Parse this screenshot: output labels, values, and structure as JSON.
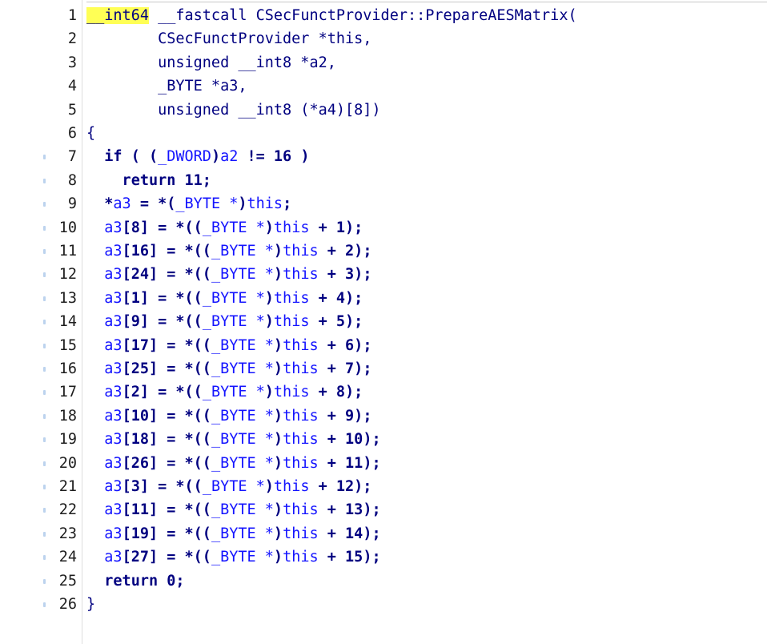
{
  "editor": {
    "lines": [
      {
        "num": "1",
        "bp": false,
        "tokens": [
          {
            "t": "__int64",
            "c": "t-hl"
          },
          {
            "t": " __fastcall CSecFunctProvider::PrepareAESMatrix(",
            "c": "t-default"
          }
        ]
      },
      {
        "num": "2",
        "bp": false,
        "tokens": [
          {
            "t": "        CSecFunctProvider *this,",
            "c": "t-default"
          }
        ]
      },
      {
        "num": "3",
        "bp": false,
        "tokens": [
          {
            "t": "        unsigned __int8 *a2,",
            "c": "t-default"
          }
        ]
      },
      {
        "num": "4",
        "bp": false,
        "tokens": [
          {
            "t": "        _BYTE *a3,",
            "c": "t-default"
          }
        ]
      },
      {
        "num": "5",
        "bp": false,
        "tokens": [
          {
            "t": "        unsigned __int8 (*a4)[8])",
            "c": "t-default"
          }
        ]
      },
      {
        "num": "6",
        "bp": false,
        "tokens": [
          {
            "t": "{",
            "c": "t-default"
          }
        ]
      },
      {
        "num": "7",
        "bp": true,
        "tokens": [
          {
            "t": "  if ( (",
            "c": "t-kw"
          },
          {
            "t": "_DWORD",
            "c": "t-type"
          },
          {
            "t": ")",
            "c": "t-kw"
          },
          {
            "t": "a2",
            "c": "t-var"
          },
          {
            "t": " != 16 )",
            "c": "t-kw"
          }
        ]
      },
      {
        "num": "8",
        "bp": true,
        "tokens": [
          {
            "t": "    return 11;",
            "c": "t-kw"
          }
        ]
      },
      {
        "num": "9",
        "bp": true,
        "tokens": [
          {
            "t": "  *",
            "c": "t-kw"
          },
          {
            "t": "a3",
            "c": "t-var"
          },
          {
            "t": " = *(",
            "c": "t-kw"
          },
          {
            "t": "_BYTE *",
            "c": "t-type"
          },
          {
            "t": ")",
            "c": "t-kw"
          },
          {
            "t": "this",
            "c": "t-var"
          },
          {
            "t": ";",
            "c": "t-kw"
          }
        ]
      },
      {
        "num": "10",
        "bp": true,
        "tokens": [
          {
            "t": "  ",
            "c": "t-kw"
          },
          {
            "t": "a3",
            "c": "t-var"
          },
          {
            "t": "[8] = *((",
            "c": "t-kw"
          },
          {
            "t": "_BYTE *",
            "c": "t-type"
          },
          {
            "t": ")",
            "c": "t-kw"
          },
          {
            "t": "this",
            "c": "t-var"
          },
          {
            "t": " + 1);",
            "c": "t-kw"
          }
        ]
      },
      {
        "num": "11",
        "bp": true,
        "tokens": [
          {
            "t": "  ",
            "c": "t-kw"
          },
          {
            "t": "a3",
            "c": "t-var"
          },
          {
            "t": "[16] = *((",
            "c": "t-kw"
          },
          {
            "t": "_BYTE *",
            "c": "t-type"
          },
          {
            "t": ")",
            "c": "t-kw"
          },
          {
            "t": "this",
            "c": "t-var"
          },
          {
            "t": " + 2);",
            "c": "t-kw"
          }
        ]
      },
      {
        "num": "12",
        "bp": true,
        "tokens": [
          {
            "t": "  ",
            "c": "t-kw"
          },
          {
            "t": "a3",
            "c": "t-var"
          },
          {
            "t": "[24] = *((",
            "c": "t-kw"
          },
          {
            "t": "_BYTE *",
            "c": "t-type"
          },
          {
            "t": ")",
            "c": "t-kw"
          },
          {
            "t": "this",
            "c": "t-var"
          },
          {
            "t": " + 3);",
            "c": "t-kw"
          }
        ]
      },
      {
        "num": "13",
        "bp": true,
        "tokens": [
          {
            "t": "  ",
            "c": "t-kw"
          },
          {
            "t": "a3",
            "c": "t-var"
          },
          {
            "t": "[1] = *((",
            "c": "t-kw"
          },
          {
            "t": "_BYTE *",
            "c": "t-type"
          },
          {
            "t": ")",
            "c": "t-kw"
          },
          {
            "t": "this",
            "c": "t-var"
          },
          {
            "t": " + 4);",
            "c": "t-kw"
          }
        ]
      },
      {
        "num": "14",
        "bp": true,
        "tokens": [
          {
            "t": "  ",
            "c": "t-kw"
          },
          {
            "t": "a3",
            "c": "t-var"
          },
          {
            "t": "[9] = *((",
            "c": "t-kw"
          },
          {
            "t": "_BYTE *",
            "c": "t-type"
          },
          {
            "t": ")",
            "c": "t-kw"
          },
          {
            "t": "this",
            "c": "t-var"
          },
          {
            "t": " + 5);",
            "c": "t-kw"
          }
        ]
      },
      {
        "num": "15",
        "bp": true,
        "tokens": [
          {
            "t": "  ",
            "c": "t-kw"
          },
          {
            "t": "a3",
            "c": "t-var"
          },
          {
            "t": "[17] = *((",
            "c": "t-kw"
          },
          {
            "t": "_BYTE *",
            "c": "t-type"
          },
          {
            "t": ")",
            "c": "t-kw"
          },
          {
            "t": "this",
            "c": "t-var"
          },
          {
            "t": " + 6);",
            "c": "t-kw"
          }
        ]
      },
      {
        "num": "16",
        "bp": true,
        "tokens": [
          {
            "t": "  ",
            "c": "t-kw"
          },
          {
            "t": "a3",
            "c": "t-var"
          },
          {
            "t": "[25] = *((",
            "c": "t-kw"
          },
          {
            "t": "_BYTE *",
            "c": "t-type"
          },
          {
            "t": ")",
            "c": "t-kw"
          },
          {
            "t": "this",
            "c": "t-var"
          },
          {
            "t": " + 7);",
            "c": "t-kw"
          }
        ]
      },
      {
        "num": "17",
        "bp": true,
        "tokens": [
          {
            "t": "  ",
            "c": "t-kw"
          },
          {
            "t": "a3",
            "c": "t-var"
          },
          {
            "t": "[2] = *((",
            "c": "t-kw"
          },
          {
            "t": "_BYTE *",
            "c": "t-type"
          },
          {
            "t": ")",
            "c": "t-kw"
          },
          {
            "t": "this",
            "c": "t-var"
          },
          {
            "t": " + 8);",
            "c": "t-kw"
          }
        ]
      },
      {
        "num": "18",
        "bp": true,
        "tokens": [
          {
            "t": "  ",
            "c": "t-kw"
          },
          {
            "t": "a3",
            "c": "t-var"
          },
          {
            "t": "[10] = *((",
            "c": "t-kw"
          },
          {
            "t": "_BYTE *",
            "c": "t-type"
          },
          {
            "t": ")",
            "c": "t-kw"
          },
          {
            "t": "this",
            "c": "t-var"
          },
          {
            "t": " + 9);",
            "c": "t-kw"
          }
        ]
      },
      {
        "num": "19",
        "bp": true,
        "tokens": [
          {
            "t": "  ",
            "c": "t-kw"
          },
          {
            "t": "a3",
            "c": "t-var"
          },
          {
            "t": "[18] = *((",
            "c": "t-kw"
          },
          {
            "t": "_BYTE *",
            "c": "t-type"
          },
          {
            "t": ")",
            "c": "t-kw"
          },
          {
            "t": "this",
            "c": "t-var"
          },
          {
            "t": " + 10);",
            "c": "t-kw"
          }
        ]
      },
      {
        "num": "20",
        "bp": true,
        "tokens": [
          {
            "t": "  ",
            "c": "t-kw"
          },
          {
            "t": "a3",
            "c": "t-var"
          },
          {
            "t": "[26] = *((",
            "c": "t-kw"
          },
          {
            "t": "_BYTE *",
            "c": "t-type"
          },
          {
            "t": ")",
            "c": "t-kw"
          },
          {
            "t": "this",
            "c": "t-var"
          },
          {
            "t": " + 11);",
            "c": "t-kw"
          }
        ]
      },
      {
        "num": "21",
        "bp": true,
        "tokens": [
          {
            "t": "  ",
            "c": "t-kw"
          },
          {
            "t": "a3",
            "c": "t-var"
          },
          {
            "t": "[3] = *((",
            "c": "t-kw"
          },
          {
            "t": "_BYTE *",
            "c": "t-type"
          },
          {
            "t": ")",
            "c": "t-kw"
          },
          {
            "t": "this",
            "c": "t-var"
          },
          {
            "t": " + 12);",
            "c": "t-kw"
          }
        ]
      },
      {
        "num": "22",
        "bp": true,
        "tokens": [
          {
            "t": "  ",
            "c": "t-kw"
          },
          {
            "t": "a3",
            "c": "t-var"
          },
          {
            "t": "[11] = *((",
            "c": "t-kw"
          },
          {
            "t": "_BYTE *",
            "c": "t-type"
          },
          {
            "t": ")",
            "c": "t-kw"
          },
          {
            "t": "this",
            "c": "t-var"
          },
          {
            "t": " + 13);",
            "c": "t-kw"
          }
        ]
      },
      {
        "num": "23",
        "bp": true,
        "tokens": [
          {
            "t": "  ",
            "c": "t-kw"
          },
          {
            "t": "a3",
            "c": "t-var"
          },
          {
            "t": "[19] = *((",
            "c": "t-kw"
          },
          {
            "t": "_BYTE *",
            "c": "t-type"
          },
          {
            "t": ")",
            "c": "t-kw"
          },
          {
            "t": "this",
            "c": "t-var"
          },
          {
            "t": " + 14);",
            "c": "t-kw"
          }
        ]
      },
      {
        "num": "24",
        "bp": true,
        "tokens": [
          {
            "t": "  ",
            "c": "t-kw"
          },
          {
            "t": "a3",
            "c": "t-var"
          },
          {
            "t": "[27] = *((",
            "c": "t-kw"
          },
          {
            "t": "_BYTE *",
            "c": "t-type"
          },
          {
            "t": ")",
            "c": "t-kw"
          },
          {
            "t": "this",
            "c": "t-var"
          },
          {
            "t": " + 15);",
            "c": "t-kw"
          }
        ]
      },
      {
        "num": "25",
        "bp": true,
        "tokens": [
          {
            "t": "  return 0;",
            "c": "t-kw"
          }
        ]
      },
      {
        "num": "26",
        "bp": true,
        "tokens": [
          {
            "t": "}",
            "c": "t-default"
          }
        ]
      }
    ],
    "colors": {
      "background": "#ffffff",
      "keyword": "#000080",
      "variable": "#1414ff",
      "highlight": "#ffff55",
      "breakpoint_marker": "#bcd3ee",
      "line_number": "#1e1e1e"
    }
  }
}
